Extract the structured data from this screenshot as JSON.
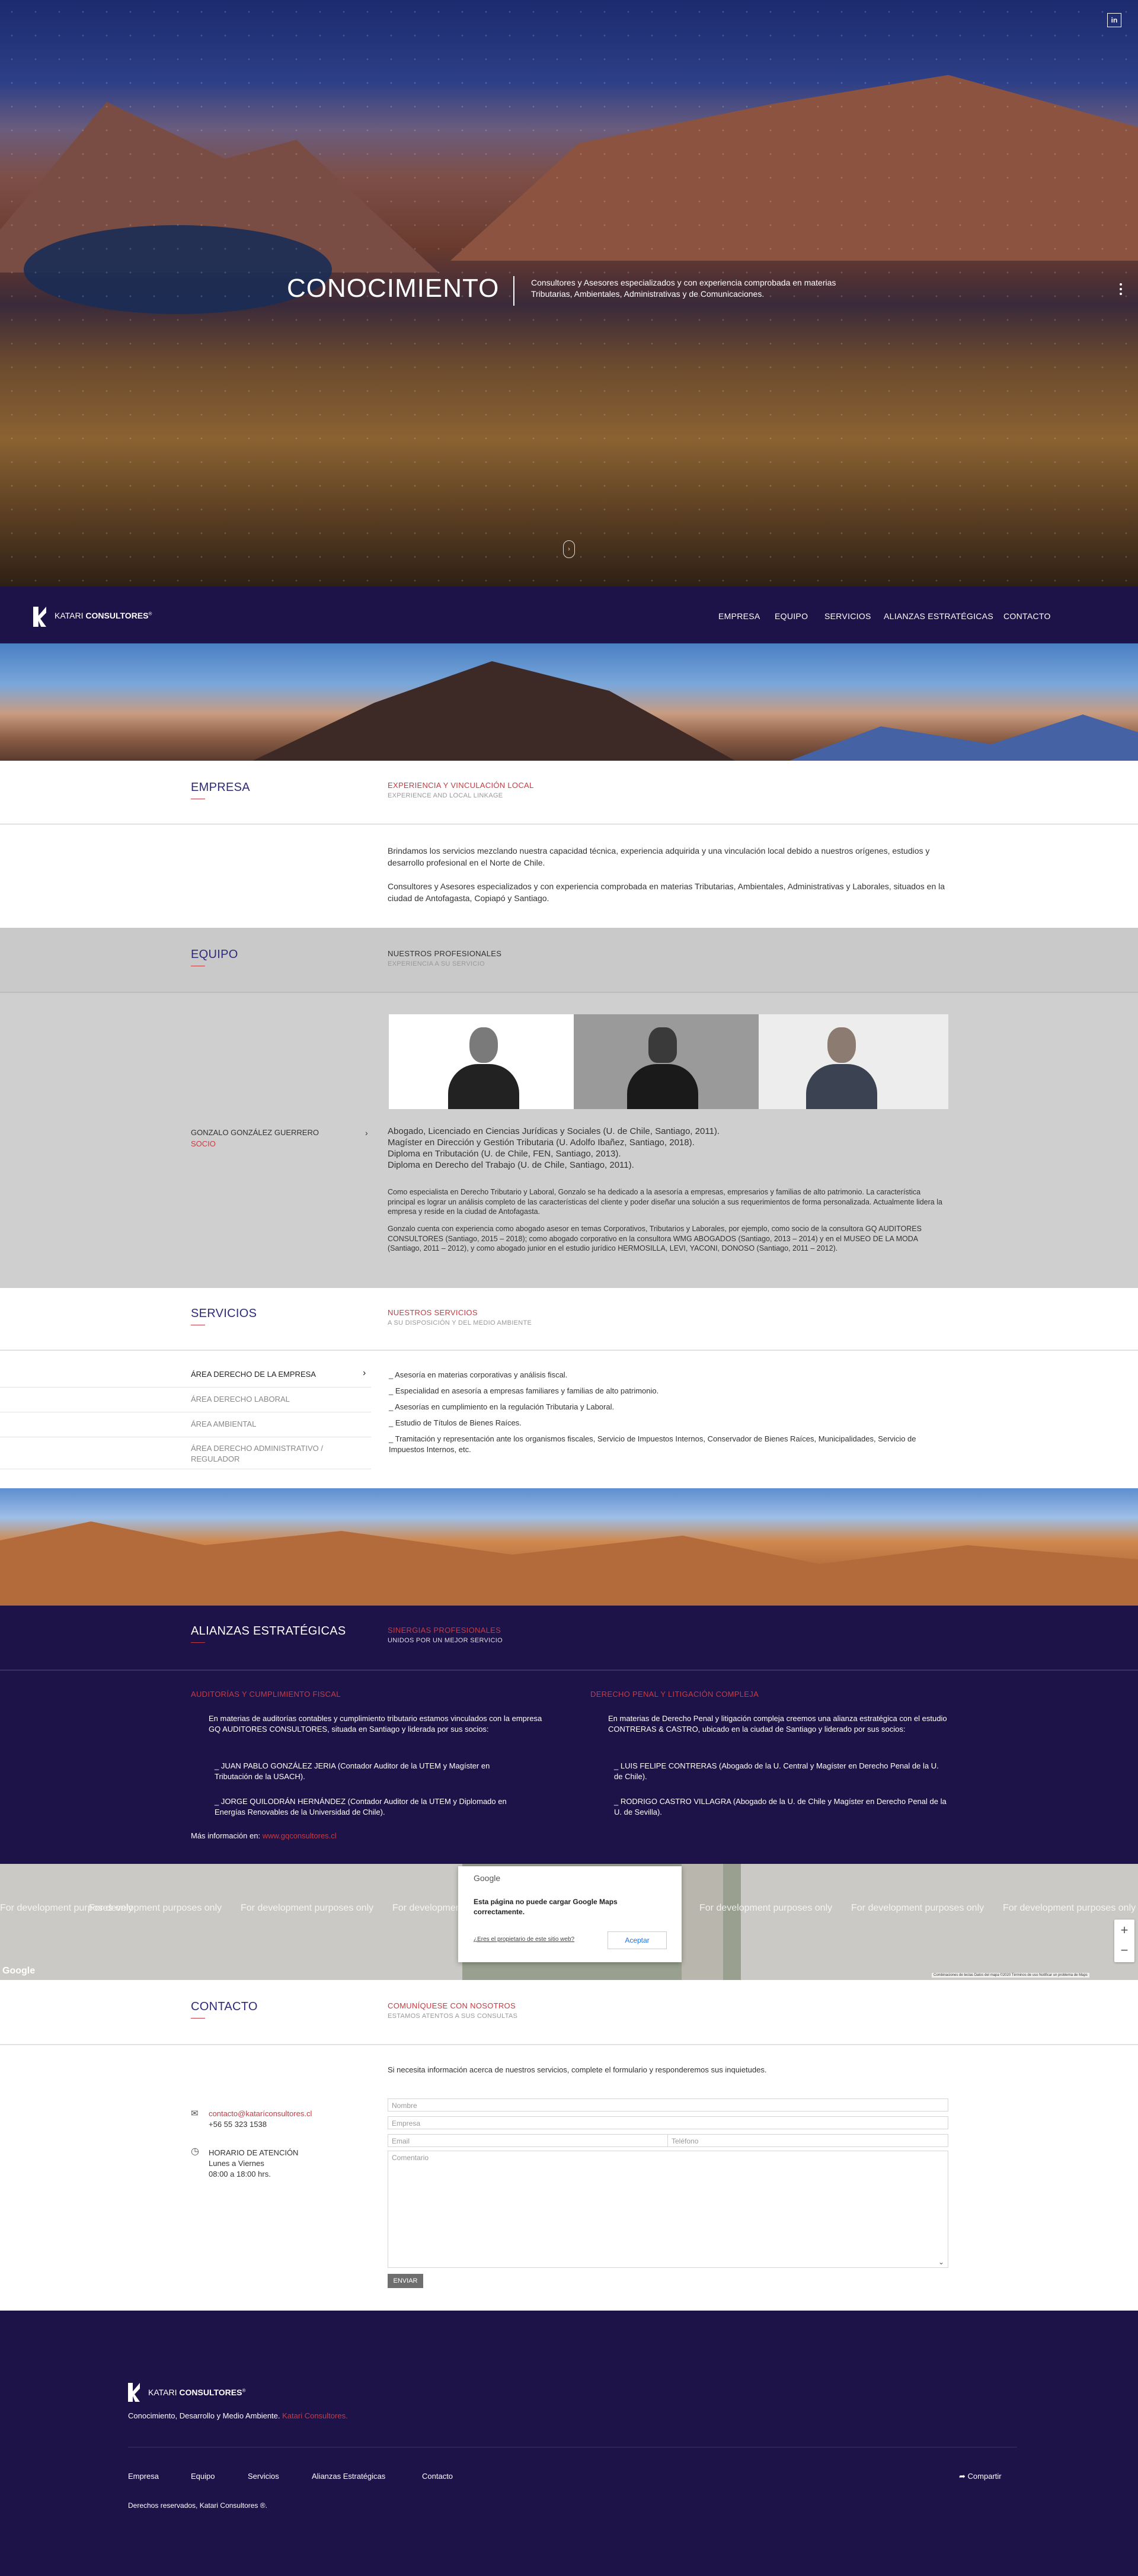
{
  "social": {
    "linkedin": "in"
  },
  "hero": {
    "title": "CONOCIMIENTO",
    "description": "Consultores y Asesores especializados y con experiencia comprobada en materias Tributarias, Ambientales, Administrativas y de Comunicaciones."
  },
  "nav": {
    "brand_a": "KATARI",
    "brand_b": "CONSULTORES",
    "mark": "®",
    "items": [
      "EMPRESA",
      "EQUIPO",
      "SERVICIOS",
      "ALIANZAS ESTRATÉGICAS",
      "CONTACTO"
    ]
  },
  "empresa": {
    "title": "EMPRESA",
    "subtitle": "EXPERIENCIA Y VINCULACIÓN LOCAL",
    "subtitle_en": "EXPERIENCE AND LOCAL LINKAGE",
    "p1": "Brindamos los servicios mezclando nuestra capacidad técnica, experiencia adquirida y una vinculación local debido a nuestros orígenes, estudios y desarrollo profesional en el Norte de Chile.",
    "p2": "Consultores y Asesores especializados y con experiencia comprobada en materias Tributarias, Ambientales, Administrativas y Laborales, situados en la ciudad de Antofagasta, Copiapó y Santiago."
  },
  "equipo": {
    "title": "EQUIPO",
    "subtitle": "NUESTROS PROFESIONALES",
    "subtitle2": "EXPERIENCIA A SU SERVICIO",
    "member_name": "GONZALO GONZÁLEZ GUERRERO",
    "member_role": "SOCIO",
    "credentials": [
      "Abogado, Licenciado en Ciencias Jurídicas y Sociales (U. de Chile, Santiago, 2011).",
      "Magíster en Dirección y Gestión Tributaria (U. Adolfo Ibañez, Santiago, 2018).",
      "Diploma en Tributación (U. de Chile, FEN, Santiago, 2013).",
      "Diploma en Derecho del Trabajo (U. de Chile, Santiago, 2011)."
    ],
    "bio1": "Como especialista en Derecho Tributario y Laboral, Gonzalo se ha dedicado a la asesoría a empresas, empresarios y familias de alto patrimonio. La característica principal es lograr un análisis completo de las características del cliente y poder diseñar una solución a sus requerimientos de forma personalizada. Actualmente lidera la empresa y reside en la ciudad de Antofagasta.",
    "bio2": "Gonzalo cuenta con experiencia como abogado asesor en temas Corporativos, Tributarios y Laborales, por ejemplo, como socio de la consultora GQ AUDITORES CONSULTORES (Santiago, 2015 – 2018); como abogado corporativo en la consultora WMG ABOGADOS (Santiago, 2013 – 2014) y en el MUSEO DE LA MODA (Santiago, 2011 – 2012), y como abogado junior en el estudio jurídico HERMOSILLA, LEVI, YACONI, DONOSO (Santiago, 2011 – 2012)."
  },
  "servicios": {
    "title": "SERVICIOS",
    "subtitle": "NUESTROS SERVICIOS",
    "subtitle2": "A SU DISPOSICIÓN Y DEL MEDIO AMBIENTE",
    "areas": [
      "ÁREA DERECHO DE LA EMPRESA",
      "ÁREA DERECHO LABORAL",
      "ÁREA AMBIENTAL",
      "ÁREA DERECHO ADMINISTRATIVO / REGULADOR"
    ],
    "bullets": [
      "_ Asesoría en materias corporativas y análisis fiscal.",
      "_ Especialidad en asesoría a empresas familiares y familias de alto patrimonio.",
      "_ Asesorías en cumplimiento en la regulación Tributaria y Laboral.",
      "_ Estudio de Títulos de Bienes Raíces.",
      "_ Tramitación y representación ante los organismos fiscales, Servicio de Impuestos Internos, Conservador de Bienes Raíces, Municipalidades, Servicio de Impuestos Internos, etc."
    ]
  },
  "alianzas": {
    "title": "ALIANZAS ESTRATÉGICAS",
    "subtitle": "SINERGIAS PROFESIONALES",
    "subtitle2": "UNIDOS POR UN MEJOR SERVICIO",
    "left_title": "AUDITORÍAS Y CUMPLIMIENTO FISCAL",
    "left_text": "En materias de auditorías contables y cumplimiento tributario estamos vinculados con la empresa GQ AUDITORES CONSULTORES, situada en Santiago y liderada por sus socios:",
    "left_p1": "_ JUAN PABLO GONZÁLEZ JERIA (Contador Auditor de la UTEM y Magíster en Tributación de la USACH).",
    "left_p2": "_ JORGE QUILODRÁN HERNÁNDEZ (Contador Auditor de la UTEM y Diplomado en Energías Renovables de la Universidad de Chile).",
    "more_label": "Más información en:",
    "more_link": "www.gqconsultores.cl",
    "right_title": "DERECHO PENAL Y LITIGACIÓN COMPLEJA",
    "right_text": "En materias de Derecho Penal y litigación compleja creemos una alianza estratégica con el estudio CONTRERAS & CASTRO, ubicado en la ciudad de Santiago y liderado por sus socios:",
    "right_p1": "_ LUIS FELIPE CONTRERAS (Abogado de la U. Central y Magíster en Derecho Penal de la U. de Chile).",
    "right_p2": "_ RODRIGO CASTRO VILLAGRA (Abogado de la U. de Chile y Magíster en Derecho Penal de la U. de Sevilla)."
  },
  "map": {
    "watermark": "For development purposes only",
    "google": "Google",
    "dialog_title": "Google",
    "dialog_msg": "Esta página no puede cargar Google Maps correctamente.",
    "dialog_link": "¿Eres el propietario de este sitio web?",
    "dialog_ok": "Aceptar",
    "zoom_in": "+",
    "zoom_out": "−",
    "footer_note": "Combinaciones de teclas  Datos del mapa ©2020  Términos de uso  Notificar un problema de Maps"
  },
  "contacto": {
    "title": "CONTACTO",
    "subtitle": "COMUNÍQUESE CON NOSOTROS",
    "subtitle2": "ESTAMOS ATENTOS A SUS CONSULTAS",
    "intro": "Si necesita información acerca de nuestros servicios, complete el formulario y responderemos sus inquietudes.",
    "email": "contacto@kataríconsultores.cl",
    "phone": "+56 55 323 1538",
    "hours_title": "HORARIO DE ATENCIÓN",
    "hours_days": "Lunes a Viernes",
    "hours_time": "08:00 a 18:00 hrs.",
    "ph_nombre": "Nombre",
    "ph_empresa": "Empresa",
    "ph_email": "Email",
    "ph_telefono": "Teléfono",
    "ph_comentario": "Comentario",
    "submit": "ENVIAR"
  },
  "footer": {
    "brand_a": "KATARI",
    "brand_b": "CONSULTORES",
    "mark": "®",
    "tagline": "Conocimiento, Desarrollo y Medio Ambiente.",
    "tagline_accent": "Katari Consultores.",
    "links": [
      "Empresa",
      "Equipo",
      "Servicios",
      "Alianzas Estratégicas",
      "Contacto"
    ],
    "share": "Compartir",
    "copyright": "Derechos reservados, Katari Consultores ®."
  },
  "colors": {
    "navy": "#1e1348",
    "accent": "#c53b43",
    "title": "#2e2a7a"
  }
}
